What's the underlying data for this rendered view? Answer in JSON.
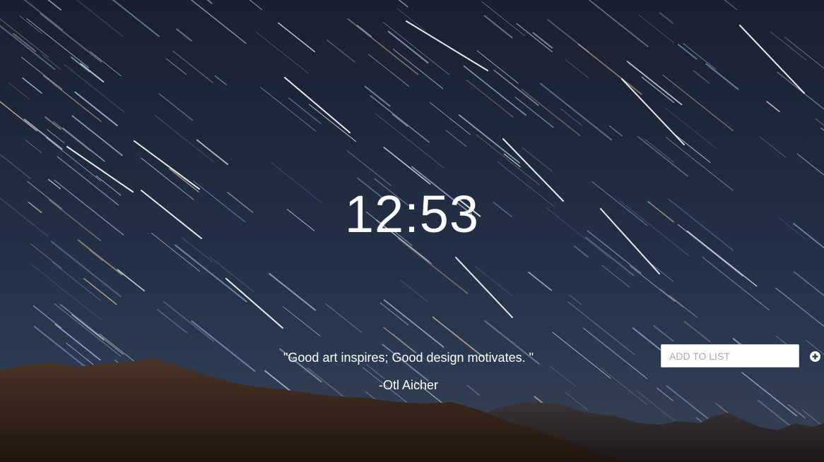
{
  "clock": {
    "time": "12:53"
  },
  "quote": {
    "text": "\"Good art inspires; Good design motivates. \"",
    "author": "-Otl Aicher"
  },
  "todo": {
    "placeholder": "ADD TO LIST",
    "add_icon": "plus-circle-icon"
  },
  "background": {
    "subject": "star-trails-over-mountains",
    "sky_color": "#1f2a3e",
    "mountain_color": "#3b2a22"
  }
}
